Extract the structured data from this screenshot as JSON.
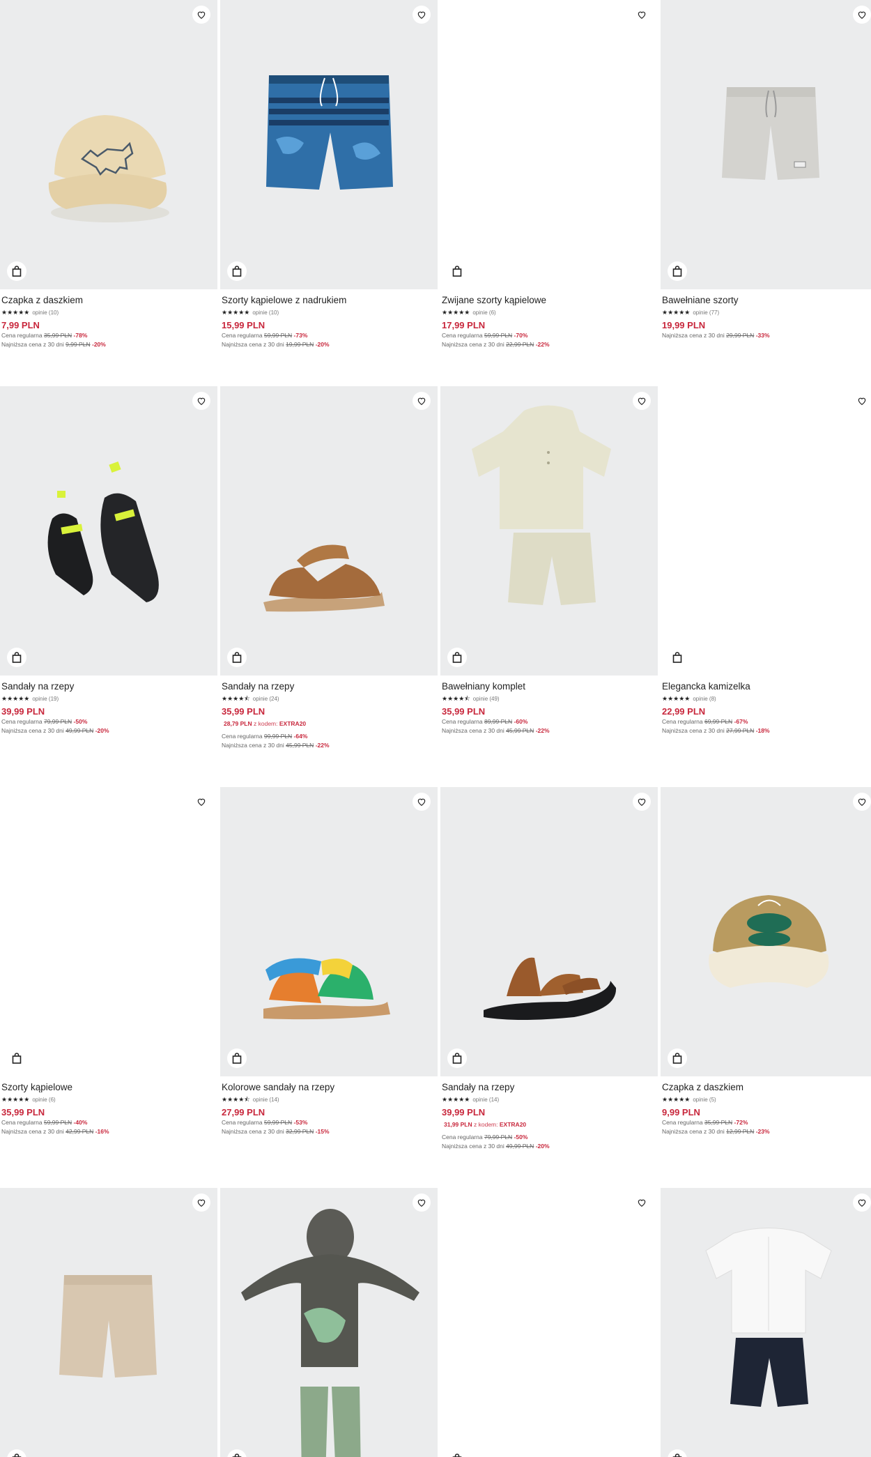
{
  "labels": {
    "regular": "Cena regularna",
    "lowest": "Najniższa cena z 30 dni",
    "code_word": "z kodem:"
  },
  "icons": {
    "favorite": "heart-outline-icon",
    "cart": "shopping-bag-icon"
  },
  "colors": {
    "price": "#c8273c",
    "image_bg": "#ebeced"
  },
  "products": [
    {
      "name": "Czapka z daszkiem",
      "rating": "★★★★★",
      "reviews": "opinie (10)",
      "price": "7,99 PLN",
      "regular_old": "35,99 PLN",
      "regular_disc": "-78%",
      "lowest_old": "9,99 PLN",
      "lowest_disc": "-20%"
    },
    {
      "name": "Szorty kąpielowe z nadrukiem",
      "rating": "★★★★★",
      "reviews": "opinie (10)",
      "price": "15,99 PLN",
      "regular_old": "59,99 PLN",
      "regular_disc": "-73%",
      "lowest_old": "19,99 PLN",
      "lowest_disc": "-20%"
    },
    {
      "name": "Zwijane szorty kąpielowe",
      "rating": "★★★★★",
      "reviews": "opinie (6)",
      "price": "17,99 PLN",
      "regular_old": "59,99 PLN",
      "regular_disc": "-70%",
      "lowest_old": "22,99 PLN",
      "lowest_disc": "-22%"
    },
    {
      "name": "Bawełniane szorty",
      "rating": "★★★★★",
      "reviews": "opinie (77)",
      "price": "19,99 PLN",
      "lowest_old": "29,99 PLN",
      "lowest_disc": "-33%"
    },
    {
      "name": "Sandały na rzepy",
      "rating": "★★★★★",
      "reviews": "opinie (19)",
      "price": "39,99 PLN",
      "regular_old": "79,99 PLN",
      "regular_disc": "-50%",
      "lowest_old": "49,99 PLN",
      "lowest_disc": "-20%"
    },
    {
      "name": "Sandały na rzepy",
      "rating": "★★★★⯪",
      "reviews": "opinie (24)",
      "price": "35,99 PLN",
      "promo_price": "28,79 PLN",
      "promo_code": "EXTRA20",
      "regular_old": "99,99 PLN",
      "regular_disc": "-64%",
      "lowest_old": "45,99 PLN",
      "lowest_disc": "-22%"
    },
    {
      "name": "Bawełniany komplet",
      "rating": "★★★★⯪",
      "reviews": "opinie (49)",
      "price": "35,99 PLN",
      "regular_old": "89,99 PLN",
      "regular_disc": "-60%",
      "lowest_old": "45,99 PLN",
      "lowest_disc": "-22%"
    },
    {
      "name": "Elegancka kamizelka",
      "rating": "★★★★★",
      "reviews": "opinie (8)",
      "price": "22,99 PLN",
      "regular_old": "69,99 PLN",
      "regular_disc": "-67%",
      "lowest_old": "27,99 PLN",
      "lowest_disc": "-18%"
    },
    {
      "name": "Szorty kąpielowe",
      "rating": "★★★★★",
      "reviews": "opinie (6)",
      "price": "35,99 PLN",
      "regular_old": "59,99 PLN",
      "regular_disc": "-40%",
      "lowest_old": "42,99 PLN",
      "lowest_disc": "-16%"
    },
    {
      "name": "Kolorowe sandały na rzepy",
      "rating": "★★★★⯪",
      "reviews": "opinie (14)",
      "price": "27,99 PLN",
      "regular_old": "59,99 PLN",
      "regular_disc": "-53%",
      "lowest_old": "32,99 PLN",
      "lowest_disc": "-15%"
    },
    {
      "name": "Sandały na rzepy",
      "rating": "★★★★★",
      "reviews": "opinie (14)",
      "price": "39,99 PLN",
      "promo_price": "31,99 PLN",
      "promo_code": "EXTRA20",
      "regular_old": "79,99 PLN",
      "regular_disc": "-50%",
      "lowest_old": "49,99 PLN",
      "lowest_disc": "-20%"
    },
    {
      "name": "Czapka z daszkiem",
      "rating": "★★★★★",
      "reviews": "opinie (5)",
      "price": "9,99 PLN",
      "regular_old": "35,99 PLN",
      "regular_disc": "-72%",
      "lowest_old": "12,99 PLN",
      "lowest_disc": "-23%"
    },
    {
      "name": "",
      "rating": "",
      "reviews": "",
      "price": ""
    },
    {
      "name": "",
      "rating": "",
      "reviews": "",
      "price": ""
    },
    {
      "name": "",
      "rating": "",
      "reviews": "",
      "price": ""
    },
    {
      "name": "",
      "rating": "",
      "reviews": "",
      "price": ""
    }
  ]
}
